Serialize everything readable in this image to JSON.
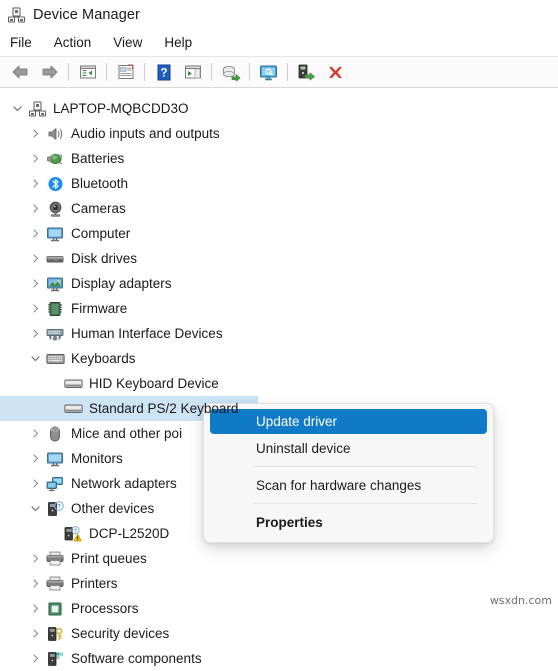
{
  "window": {
    "title": "Device Manager",
    "icon": "device-manager-icon"
  },
  "menubar": {
    "items": [
      {
        "label": "File",
        "name": "menu-file"
      },
      {
        "label": "Action",
        "name": "menu-action"
      },
      {
        "label": "View",
        "name": "menu-view"
      },
      {
        "label": "Help",
        "name": "menu-help"
      }
    ]
  },
  "toolbar": {
    "buttons": [
      {
        "icon": "back-arrow-icon",
        "name": "toolbar-back"
      },
      {
        "icon": "forward-arrow-icon",
        "name": "toolbar-forward"
      },
      {
        "icon": "show-hide-console-tree-icon",
        "name": "toolbar-console-tree"
      },
      {
        "icon": "properties-icon",
        "name": "toolbar-properties"
      },
      {
        "icon": "help-icon",
        "name": "toolbar-help"
      },
      {
        "icon": "show-hide-action-pane-icon",
        "name": "toolbar-action-pane"
      },
      {
        "icon": "update-driver-icon",
        "name": "toolbar-update-driver"
      },
      {
        "icon": "scan-for-hardware-changes-icon",
        "name": "toolbar-scan-hardware"
      },
      {
        "icon": "enable-device-icon",
        "name": "toolbar-enable-device"
      },
      {
        "icon": "uninstall-device-icon",
        "name": "toolbar-uninstall-device"
      }
    ]
  },
  "tree": {
    "nodes": [
      {
        "label": "LAPTOP-MQBCDD3O",
        "depth": 0,
        "state": "expanded",
        "icon": "computer-root-icon",
        "selected": false
      },
      {
        "label": "Audio inputs and outputs",
        "depth": 1,
        "state": "collapsed",
        "icon": "speaker-icon",
        "selected": false
      },
      {
        "label": "Batteries",
        "depth": 1,
        "state": "collapsed",
        "icon": "battery-icon",
        "selected": false
      },
      {
        "label": "Bluetooth",
        "depth": 1,
        "state": "collapsed",
        "icon": "bluetooth-icon",
        "selected": false
      },
      {
        "label": "Cameras",
        "depth": 1,
        "state": "collapsed",
        "icon": "camera-icon",
        "selected": false
      },
      {
        "label": "Computer",
        "depth": 1,
        "state": "collapsed",
        "icon": "monitor-icon",
        "selected": false
      },
      {
        "label": "Disk drives",
        "depth": 1,
        "state": "collapsed",
        "icon": "disk-drive-icon",
        "selected": false
      },
      {
        "label": "Display adapters",
        "depth": 1,
        "state": "collapsed",
        "icon": "display-adapter-icon",
        "selected": false
      },
      {
        "label": "Firmware",
        "depth": 1,
        "state": "collapsed",
        "icon": "firmware-chip-icon",
        "selected": false
      },
      {
        "label": "Human Interface Devices",
        "depth": 1,
        "state": "collapsed",
        "icon": "hid-icon",
        "selected": false
      },
      {
        "label": "Keyboards",
        "depth": 1,
        "state": "expanded",
        "icon": "keyboard-icon",
        "selected": false
      },
      {
        "label": "HID Keyboard Device",
        "depth": 2,
        "state": "leaf",
        "icon": "keyboard-device-icon",
        "selected": false
      },
      {
        "label": "Standard PS/2 Keyboard",
        "depth": 2,
        "state": "leaf",
        "icon": "keyboard-device-icon",
        "selected": true
      },
      {
        "label": "Mice and other poi",
        "depth": 1,
        "state": "collapsed",
        "icon": "mouse-icon",
        "selected": false
      },
      {
        "label": "Monitors",
        "depth": 1,
        "state": "collapsed",
        "icon": "monitor-icon",
        "selected": false
      },
      {
        "label": "Network adapters",
        "depth": 1,
        "state": "collapsed",
        "icon": "network-adapter-icon",
        "selected": false
      },
      {
        "label": "Other devices",
        "depth": 1,
        "state": "expanded",
        "icon": "unknown-device-icon",
        "selected": false
      },
      {
        "label": "DCP-L2520D",
        "depth": 2,
        "state": "leaf",
        "icon": "unknown-device-warning-icon",
        "selected": false
      },
      {
        "label": "Print queues",
        "depth": 1,
        "state": "collapsed",
        "icon": "printer-icon",
        "selected": false
      },
      {
        "label": "Printers",
        "depth": 1,
        "state": "collapsed",
        "icon": "printer-icon",
        "selected": false
      },
      {
        "label": "Processors",
        "depth": 1,
        "state": "collapsed",
        "icon": "processor-icon",
        "selected": false
      },
      {
        "label": "Security devices",
        "depth": 1,
        "state": "collapsed",
        "icon": "security-device-icon",
        "selected": false
      },
      {
        "label": "Software components",
        "depth": 1,
        "state": "collapsed",
        "icon": "software-component-icon",
        "selected": false
      }
    ]
  },
  "context_menu": {
    "items": [
      {
        "label": "Update driver",
        "name": "ctx-update-driver",
        "highlight": true,
        "bold": false
      },
      {
        "label": "Uninstall device",
        "name": "ctx-uninstall-device",
        "highlight": false,
        "bold": false
      },
      {
        "label": "Scan for hardware changes",
        "name": "ctx-scan-hardware-changes",
        "highlight": false,
        "bold": false
      },
      {
        "label": "Properties",
        "name": "ctx-properties",
        "highlight": false,
        "bold": true
      }
    ]
  },
  "watermark": {
    "text": "wsxdn.com"
  },
  "colors": {
    "selection_blue": "#0f7ac7",
    "row_selection": "#cde4f7",
    "bluetooth_blue": "#1a8cf0",
    "warning_yellow": "#ffc107",
    "close_red": "#d63b2f"
  }
}
